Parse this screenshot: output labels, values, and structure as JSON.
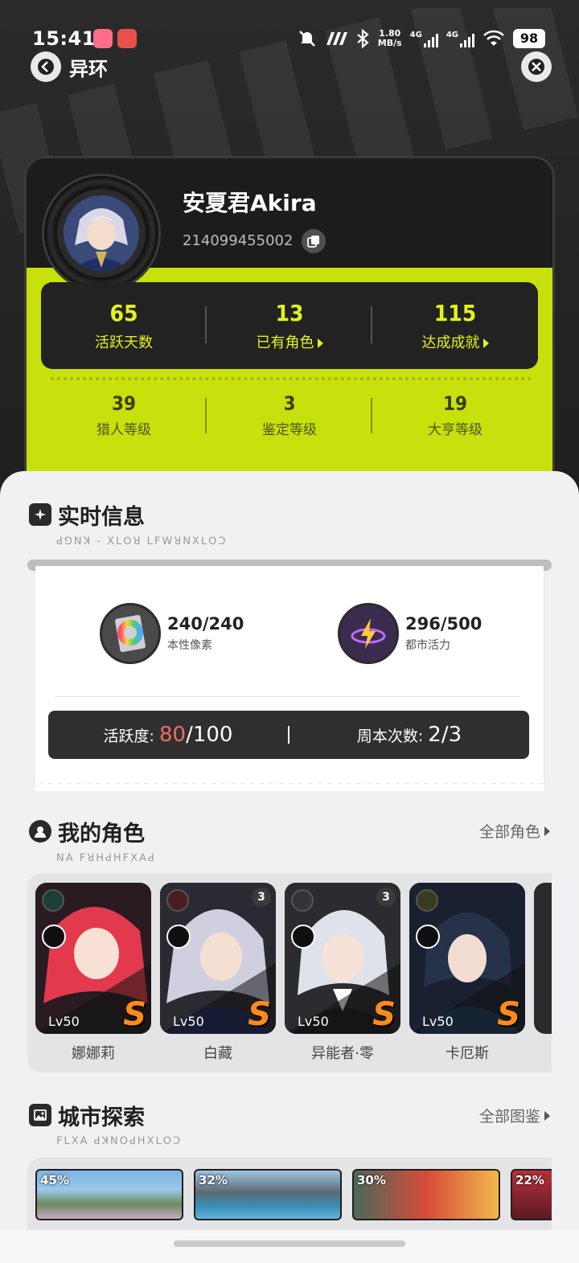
{
  "status": {
    "time": "15:41",
    "net_speed_top": "1.80",
    "net_speed_unit": "MB/s",
    "net_a": "4G",
    "net_b": "4G",
    "battery": "98"
  },
  "nav": {
    "title": "异环"
  },
  "profile": {
    "name": "安夏君Akira",
    "uid": "214099455002",
    "stats_primary": [
      {
        "value": "65",
        "label": "活跃天数"
      },
      {
        "value": "13",
        "label": "已有角色"
      },
      {
        "value": "115",
        "label": "达成成就"
      }
    ],
    "stats_secondary": [
      {
        "value": "39",
        "label": "猎人等级"
      },
      {
        "value": "3",
        "label": "鉴定等级"
      },
      {
        "value": "19",
        "label": "大亨等级"
      }
    ]
  },
  "realtime": {
    "title": "实时信息",
    "subtitle": "ꓒꓨꓠꓘ - ꓫꓡꓳꓤ ꓡꓝꓪꓤꓠꓫꓡꓳꓛ",
    "resources": [
      {
        "value": "240/240",
        "label": "本性像素",
        "icon": "color-wheel-card-icon"
      },
      {
        "value": "296/500",
        "label": "都市活力",
        "icon": "lightning-orbit-icon"
      }
    ],
    "activity_label": "活跃度:",
    "activity_current": "80",
    "activity_max": "/100",
    "weekly_label": "周本次数:",
    "weekly_value": "2/3"
  },
  "characters": {
    "title": "我的角色",
    "subtitle": "ꓠꓮ ꓝꓤꓧꓒꓧꓝꓫꓮꓒ",
    "link": "全部角色",
    "items": [
      {
        "name": "娜娜莉",
        "level": "Lv50",
        "rank": "",
        "art": "#e23a4c"
      },
      {
        "name": "白藏",
        "level": "Lv50",
        "rank": "3",
        "art": "#c8c8d8"
      },
      {
        "name": "异能者·零",
        "level": "Lv50",
        "rank": "3",
        "art": "#d8dce4"
      },
      {
        "name": "卡厄斯",
        "level": "Lv50",
        "rank": "",
        "art": "#26314a"
      }
    ],
    "rank_letter": "S"
  },
  "city": {
    "title": "城市探索",
    "subtitle": "ꓝꓡꓫꓮ ꓒꓘꓠꓳꓒꓧꓫꓡꓳꓛ",
    "link": "全部图鉴",
    "items": [
      {
        "pct": "45%"
      },
      {
        "pct": "32%"
      },
      {
        "pct": "30%"
      },
      {
        "pct": "22%"
      }
    ]
  }
}
